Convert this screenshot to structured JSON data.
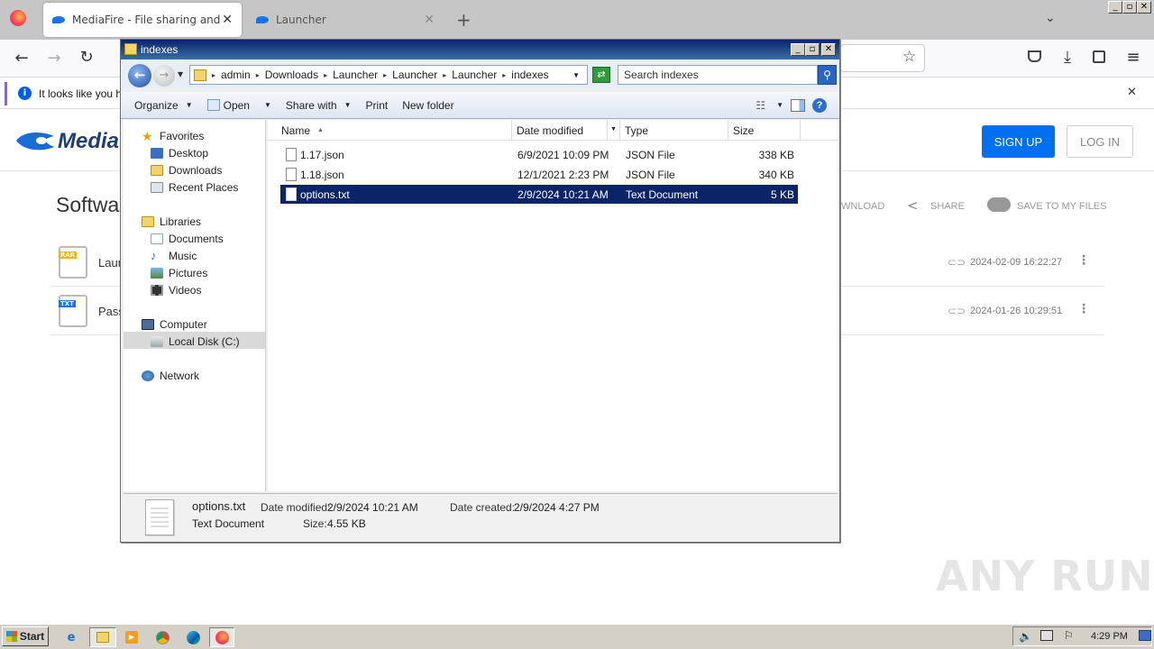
{
  "browser": {
    "tabs": [
      {
        "title": "MediaFire - File sharing and storage",
        "close": "✕"
      },
      {
        "title": "Launcher",
        "close": "✕"
      }
    ],
    "new_tab": "+",
    "notification_text": "It looks like you ha",
    "window_controls": {
      "min": "_",
      "max": "▫",
      "close": "✕"
    }
  },
  "mediafire": {
    "logo_text": "Media",
    "signup_label": "SIGN UP",
    "login_label": "LOG IN",
    "heading": "Softwa",
    "download_label": "WNLOAD",
    "share_label": "SHARE",
    "save_label": "SAVE TO MY FILES",
    "files": [
      {
        "name": "Laun",
        "badge": "RAR",
        "date": "2024-02-09 16:22:27"
      },
      {
        "name": "Pass",
        "badge": "TXT",
        "date": "2024-01-26 10:29:51"
      }
    ]
  },
  "explorer": {
    "title": "indexes",
    "breadcrumb": [
      "admin",
      "Downloads",
      "Launcher",
      "Launcher",
      "Launcher",
      "indexes"
    ],
    "search_placeholder": "Search indexes",
    "toolbar": {
      "organize": "Organize",
      "open": "Open",
      "share_with": "Share with",
      "print": "Print",
      "new_folder": "New folder"
    },
    "nav": {
      "favorites": "Favorites",
      "desktop": "Desktop",
      "downloads": "Downloads",
      "recent": "Recent Places",
      "libraries": "Libraries",
      "documents": "Documents",
      "music": "Music",
      "pictures": "Pictures",
      "videos": "Videos",
      "computer": "Computer",
      "local_disk": "Local Disk (C:)",
      "network": "Network"
    },
    "columns": {
      "name": "Name",
      "date": "Date modified",
      "type": "Type",
      "size": "Size"
    },
    "files": [
      {
        "name": "1.17.json",
        "date": "6/9/2021 10:09 PM",
        "type": "JSON File",
        "size": "338 KB"
      },
      {
        "name": "1.18.json",
        "date": "12/1/2021 2:23 PM",
        "type": "JSON File",
        "size": "340 KB"
      },
      {
        "name": "options.txt",
        "date": "2/9/2024 10:21 AM",
        "type": "Text Document",
        "size": "5 KB"
      }
    ],
    "details": {
      "filename": "options.txt",
      "filetype": "Text Document",
      "modified_label": "Date modified:",
      "modified_value": "2/9/2024 10:21 AM",
      "size_label": "Size:",
      "size_value": "4.55 KB",
      "created_label": "Date created:",
      "created_value": "2/9/2024 4:27 PM"
    }
  },
  "taskbar": {
    "start": "Start",
    "clock": "4:29 PM"
  },
  "watermark": "ANY RUN"
}
